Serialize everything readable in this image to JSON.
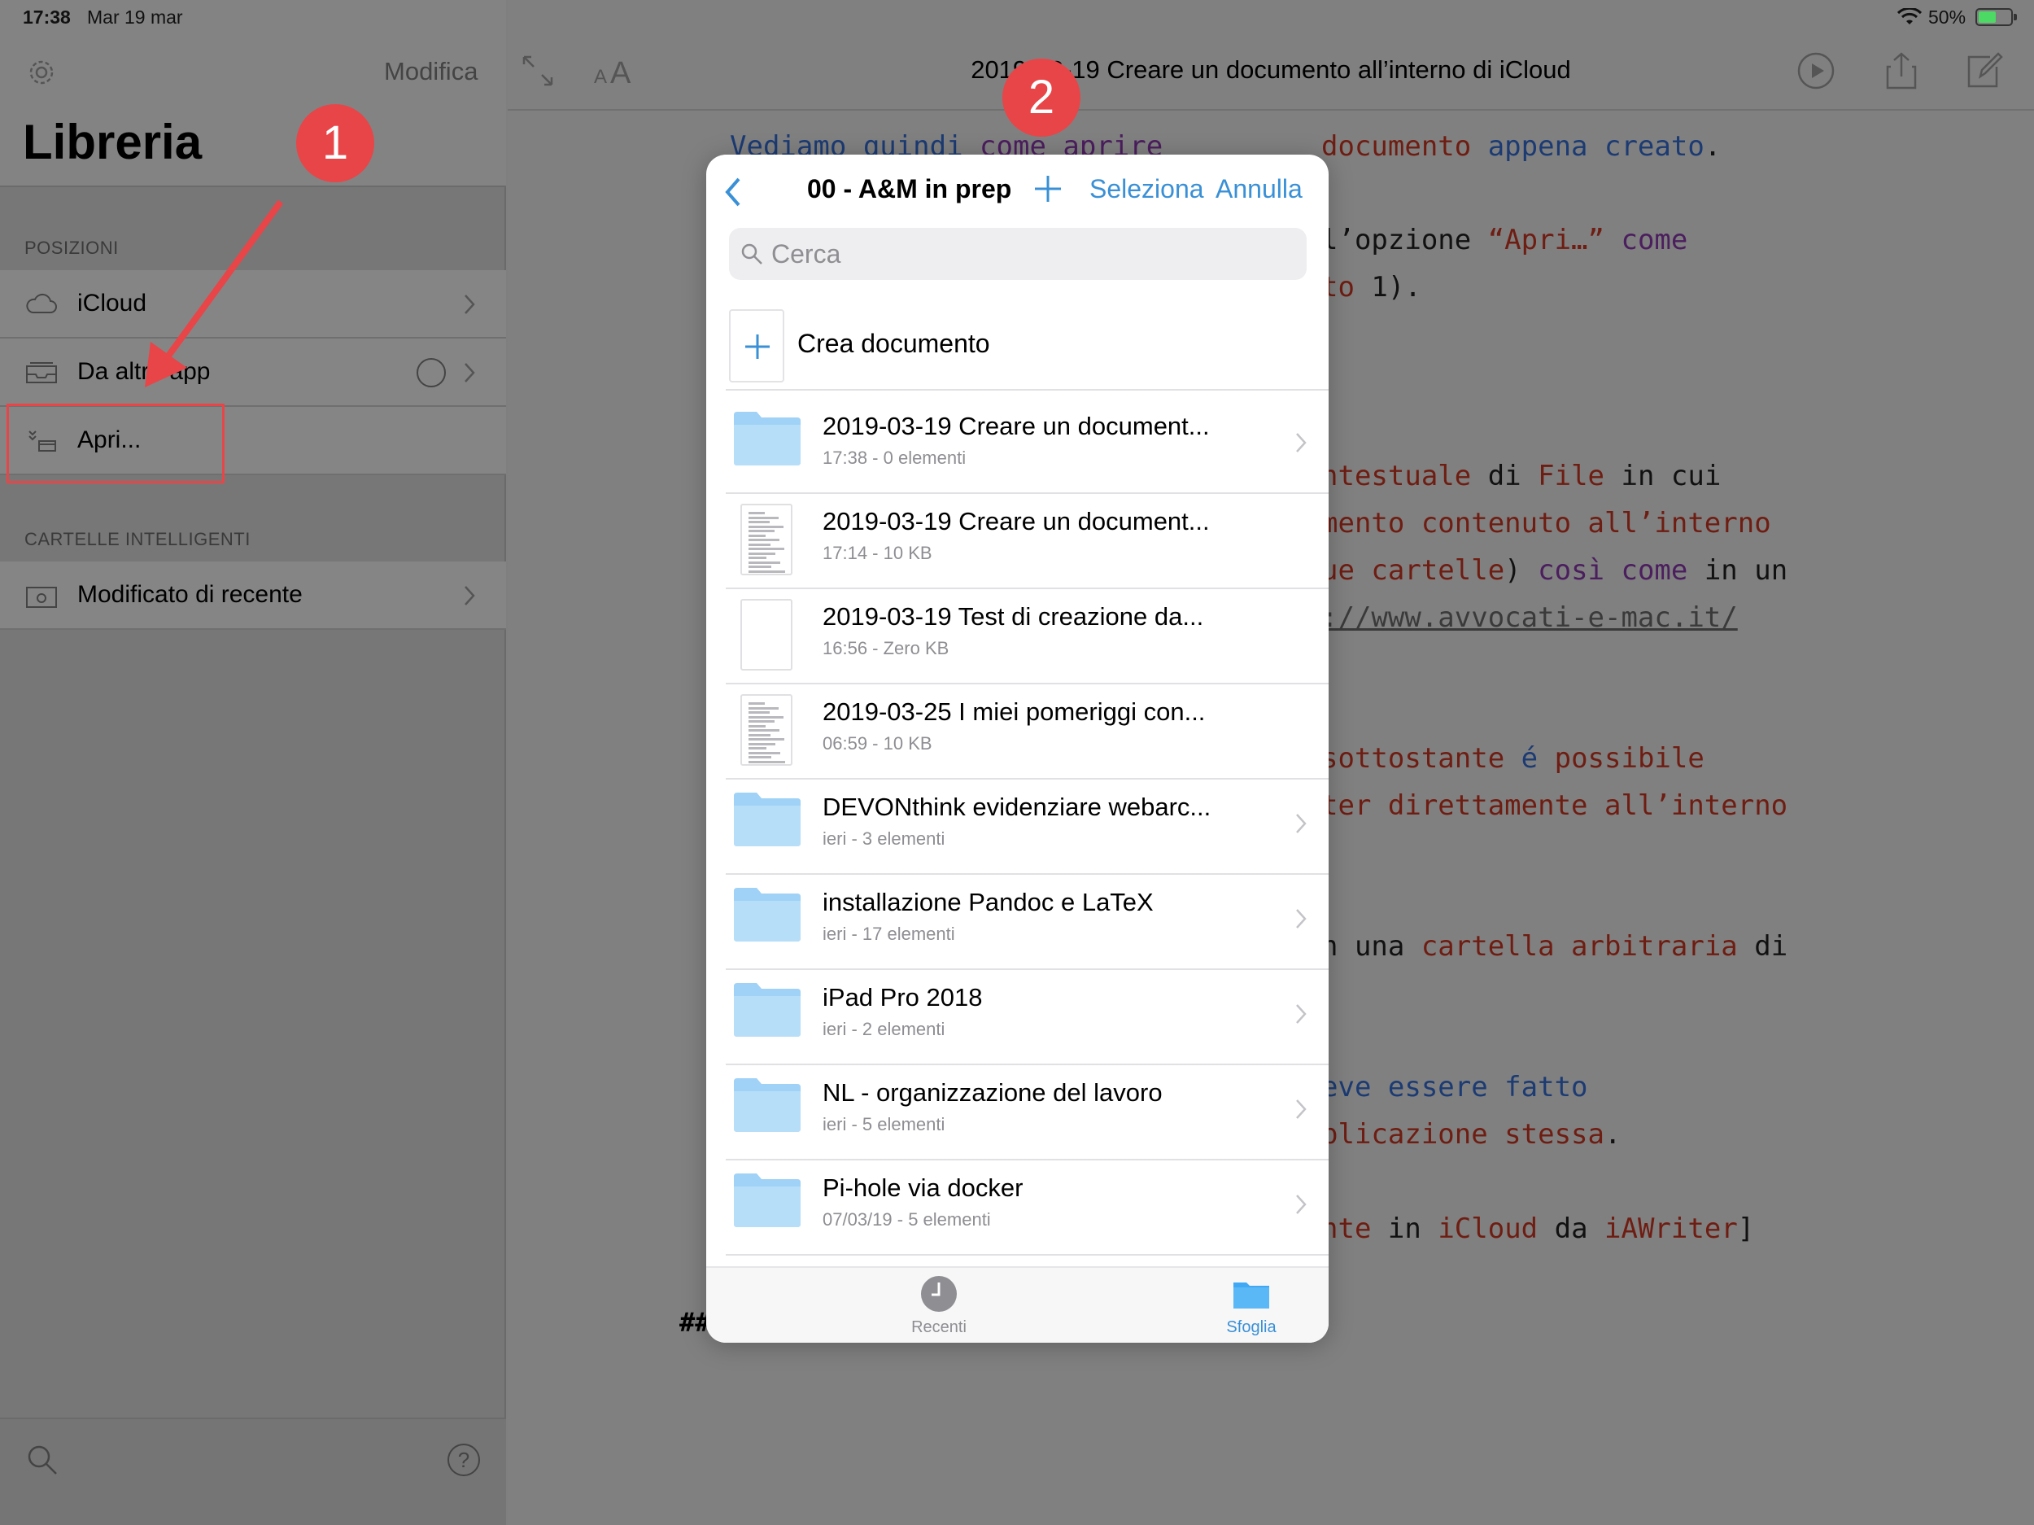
{
  "status_bar": {
    "time": "17:38",
    "date": "Mar 19 mar",
    "battery": "50%"
  },
  "sidebar": {
    "edit_label": "Modifica",
    "title": "Libreria",
    "locations_header": "POSIZIONI",
    "locations": [
      {
        "label": "iCloud",
        "icon": "cloud-icon"
      },
      {
        "label": "Da altre app",
        "icon": "inbox-icon"
      },
      {
        "label": "Apri...",
        "icon": "open-icon"
      }
    ],
    "smart_header": "CARTELLE INTELLIGENTI",
    "smart_folders": [
      {
        "label": "Modificato di recente",
        "icon": "recent-folder-icon"
      }
    ]
  },
  "annotations": {
    "badge_1": "1",
    "badge_2": "2",
    "accent": "#e84548"
  },
  "editor": {
    "doc_title": "2019-03-19 Creare un documento all’interno di iCloud",
    "heading_mark": "##"
  },
  "picker": {
    "folder_title": "00 - A&M in prep",
    "select_label": "Seleziona",
    "cancel_label": "Annulla",
    "search_placeholder": "Cerca",
    "create_label": "Crea documento",
    "accent": "#3a90d6",
    "files": [
      {
        "name": "2019-03-19 Creare un document...",
        "meta": "17:38 - 0 elementi",
        "kind": "folder"
      },
      {
        "name": "2019-03-19 Creare un document...",
        "meta": "17:14 - 10 KB",
        "kind": "doc"
      },
      {
        "name": "2019-03-19 Test di creazione da...",
        "meta": "16:56 - Zero KB",
        "kind": "blank"
      },
      {
        "name": "2019-03-25 I miei pomeriggi con...",
        "meta": "06:59 - 10 KB",
        "kind": "doc"
      },
      {
        "name": "DEVONthink evidenziare webarc...",
        "meta": "ieri - 3 elementi",
        "kind": "folder"
      },
      {
        "name": "installazione Pandoc e LaTeX",
        "meta": "ieri - 17 elementi",
        "kind": "folder"
      },
      {
        "name": "iPad Pro 2018",
        "meta": "ieri - 2 elementi",
        "kind": "folder"
      },
      {
        "name": "NL - organizzazione del lavoro",
        "meta": "ieri - 5 elementi",
        "kind": "folder"
      },
      {
        "name": "Pi-hole via docker",
        "meta": "07/03/19 - 5 elementi",
        "kind": "folder"
      }
    ],
    "tabs": [
      {
        "label": "Recenti"
      },
      {
        "label": "Sfoglia"
      }
    ]
  }
}
